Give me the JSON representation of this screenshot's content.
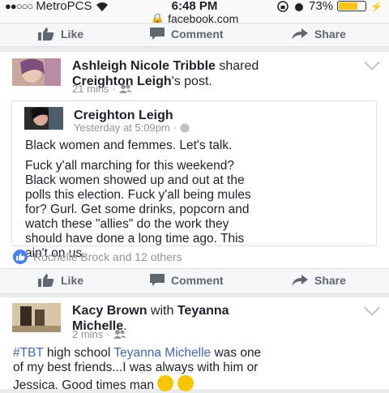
{
  "status": {
    "carrier": "MetroPCS",
    "time": "6:48 PM",
    "url": "facebook.com",
    "battery": "73%",
    "battery_level": 0.73
  },
  "actions": {
    "like": "Like",
    "comment": "Comment",
    "share": "Share"
  },
  "post1": {
    "author": "Ashleigh Nicole Tribble",
    "verb": "shared",
    "target": "Creighton Leigh",
    "target_suffix": "'s post.",
    "time": "21 mins",
    "shared": {
      "author": "Creighton Leigh",
      "time": "Yesterday at 5:09pm",
      "line1": "Black women and femmes. Let's talk.",
      "body": [
        "Fuck y'all marching for this weekend?",
        "Black women showed up and out at the",
        "polls this election. Fuck y'all being mules",
        "for? Gurl. Get some drinks, popcorn and",
        "watch these \"allies\" do the work they",
        "should have done a long time ago. This",
        "ain't on us."
      ]
    },
    "reactions": "Rochelle Brock and 12 others"
  },
  "post2": {
    "author": "Kacy Brown",
    "with": "with",
    "tagged_line1": "Teyanna",
    "tagged_line2": "Michelle",
    "time": "2 mins",
    "hashtag": "#TBT",
    "text_a": " high school ",
    "mention": "Teyanna Michelle",
    "text_b": " was one",
    "line2": "of my best friends...I was always with him or",
    "line3": "Jessica. Good times man"
  }
}
